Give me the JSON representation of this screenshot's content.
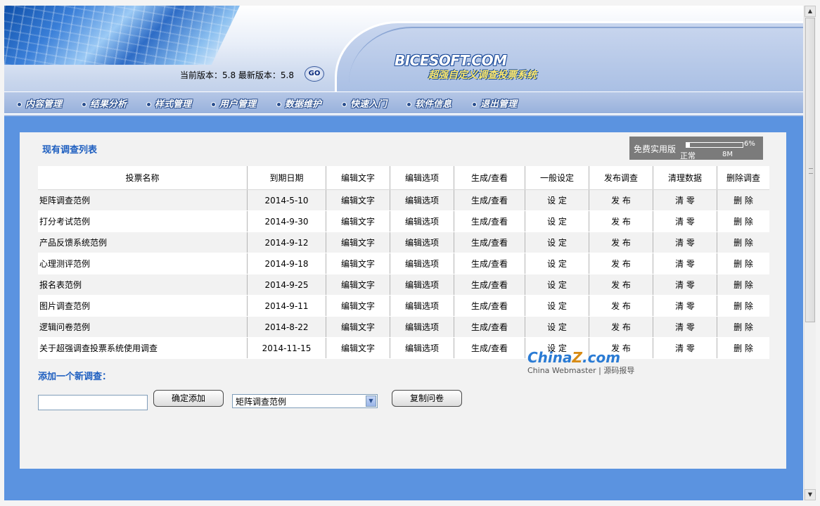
{
  "header": {
    "version_text": "当前版本：5.8 最新版本：5.8",
    "go_label": "GO",
    "logo": "BICESOFT.COM",
    "logo_subtitle": "超强自定义调查投票系统"
  },
  "nav": {
    "items": [
      {
        "label": "内容管理"
      },
      {
        "label": "结果分析"
      },
      {
        "label": "样式管理"
      },
      {
        "label": "用户管理"
      },
      {
        "label": "数据维护"
      },
      {
        "label": "快速入门"
      },
      {
        "label": "软件信息"
      },
      {
        "label": "退出管理"
      }
    ]
  },
  "main": {
    "list_title": "现有调查列表",
    "usage": {
      "label": "免费实用版",
      "percent_text": "6%",
      "percent_value": 6,
      "status": "正常",
      "size": "8M"
    },
    "table": {
      "headers": [
        "投票名称",
        "到期日期",
        "编辑文字",
        "编辑选项",
        "生成/查看",
        "一般设定",
        "发布调查",
        "清理数据",
        "删除调查"
      ],
      "rows": [
        {
          "name": "矩阵调查范例",
          "date": "2014-5-10",
          "edit_text": "编辑文字",
          "edit_options": "编辑选项",
          "generate": "生成/查看",
          "settings": "设 定",
          "publish": "发 布",
          "clear": "清 零",
          "delete": "删 除"
        },
        {
          "name": "打分考试范例",
          "date": "2014-9-30",
          "edit_text": "编辑文字",
          "edit_options": "编辑选项",
          "generate": "生成/查看",
          "settings": "设 定",
          "publish": "发 布",
          "clear": "清 零",
          "delete": "删 除"
        },
        {
          "name": "产品反馈系统范例",
          "date": "2014-9-12",
          "edit_text": "编辑文字",
          "edit_options": "编辑选项",
          "generate": "生成/查看",
          "settings": "设 定",
          "publish": "发 布",
          "clear": "清 零",
          "delete": "删 除"
        },
        {
          "name": "心理测评范例",
          "date": "2014-9-18",
          "edit_text": "编辑文字",
          "edit_options": "编辑选项",
          "generate": "生成/查看",
          "settings": "设 定",
          "publish": "发 布",
          "clear": "清 零",
          "delete": "删 除"
        },
        {
          "name": "报名表范例",
          "date": "2014-9-25",
          "edit_text": "编辑文字",
          "edit_options": "编辑选项",
          "generate": "生成/查看",
          "settings": "设 定",
          "publish": "发 布",
          "clear": "清 零",
          "delete": "删 除"
        },
        {
          "name": "图片调查范例",
          "date": "2014-9-11",
          "edit_text": "编辑文字",
          "edit_options": "编辑选项",
          "generate": "生成/查看",
          "settings": "设 定",
          "publish": "发 布",
          "clear": "清 零",
          "delete": "删 除"
        },
        {
          "name": "逻辑问卷范例",
          "date": "2014-8-22",
          "edit_text": "编辑文字",
          "edit_options": "编辑选项",
          "generate": "生成/查看",
          "settings": "设 定",
          "publish": "发 布",
          "clear": "清 零",
          "delete": "删 除"
        },
        {
          "name": "关于超强调查投票系统使用调查",
          "date": "2014-11-15",
          "edit_text": "编辑文字",
          "edit_options": "编辑选项",
          "generate": "生成/查看",
          "settings": "设 定",
          "publish": "发 布",
          "clear": "清 零",
          "delete": "删 除"
        }
      ]
    },
    "add": {
      "title": "添加一个新调查：",
      "input_value": "",
      "confirm_label": "确定添加",
      "template_selected": "矩阵调查范例",
      "copy_label": "复制问卷"
    },
    "watermark": {
      "main_a": "China",
      "main_b": "Z",
      "main_c": ".com",
      "sub": "China Webmaster | 源码报导"
    }
  }
}
